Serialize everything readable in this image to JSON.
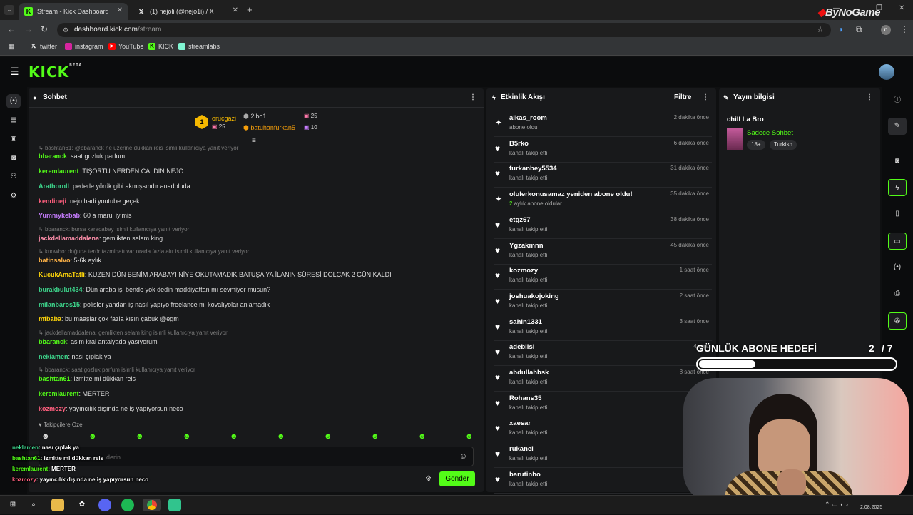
{
  "browser": {
    "tabs": [
      {
        "title": "Stream - Kick Dashboard",
        "active": true
      },
      {
        "title": "(1) nejoli (@nejo1i) / X",
        "active": false
      }
    ],
    "url_host": "dashboard.kick.com",
    "url_path": "/stream",
    "bookmarks": [
      "twitter",
      "instagram",
      "YouTube",
      "KICK",
      "streamlabs"
    ],
    "watermark": "ByNoGame"
  },
  "kick": {
    "logo": "KICK",
    "logo_badge": "BETA"
  },
  "chat": {
    "title": "Sohbet",
    "leaderboard": [
      {
        "rank": "1",
        "name": "orucgazi",
        "value": "25"
      },
      {
        "name": "2ibo1",
        "value": "25"
      },
      {
        "name": "batuhanfurkan5",
        "value": "10"
      }
    ],
    "messages": [
      {
        "type": "reply",
        "text": "bashtan61: @bbaranck ne üzerine dükkan reis isimli kullanıcıya yanıt veriyor"
      },
      {
        "type": "msg",
        "user": "bbaranck",
        "color": "#53fc18",
        "text": ": saat gozluk parfum"
      },
      {
        "type": "msg",
        "user": "keremlaurent",
        "color": "#53fc18",
        "text": ": TİŞÖRTÜ NERDEN CALDIN NEJO"
      },
      {
        "type": "msg",
        "user": "Arathornll",
        "color": "#3dd68c",
        "text": ": pederle yörük gibi akmışsındır anadoluda"
      },
      {
        "type": "msg",
        "user": "kendineji",
        "color": "#ff5f7e",
        "text": ": nejo hadi youtube geçek"
      },
      {
        "type": "msg",
        "user": "Yummykebab",
        "color": "#c77dff",
        "text": ": 60 a marul iyimis"
      },
      {
        "type": "reply",
        "text": "bbaranck: bursa karacabey isimli kullanıcıya yanıt veriyor"
      },
      {
        "type": "msg",
        "user": "jackdellamaddalena",
        "color": "#ff8fab",
        "text": ": gemlikten selam king"
      },
      {
        "type": "reply",
        "text": "knowho: doğuda terör tazminatı var orada fazla alır isimli kullanıcıya yanıt veriyor"
      },
      {
        "type": "msg",
        "user": "batinsalvo",
        "color": "#ffb347",
        "text": ": 5-6k aylık"
      },
      {
        "type": "msg",
        "user": "KucukAmaTatli",
        "color": "#ffd60a",
        "text": ": KUZEN DÜN BENİM ARABAYI NİYE OKUTAMADIK BATUŞA YA İLANIN SÜRESİ DOLCAK 2 GÜN KALDI"
      },
      {
        "type": "msg",
        "user": "burakbulut434",
        "color": "#3dd68c",
        "text": ": Dün araba işi bende yok dedin maddiyattan mı sevmiyor musun?"
      },
      {
        "type": "msg",
        "user": "milanbaros15",
        "color": "#3dd68c",
        "text": ": polisler yandan iş nasıl yapıyo freelance mi kovalıyolar anlamadık"
      },
      {
        "type": "msg",
        "user": "mfbaba",
        "color": "#ffd60a",
        "text": ": bu maaşlar çok fazla kısın çabuk @egm"
      },
      {
        "type": "reply",
        "text": "jackdellamaddalena: gemlikten selam king isimli kullanıcıya yanıt veriyor"
      },
      {
        "type": "msg",
        "user": "bbaranck",
        "color": "#53fc18",
        "text": ": aslm kral antalyada yasıyorum"
      },
      {
        "type": "msg",
        "user": "neklamen",
        "color": "#3dd68c",
        "text": ": nası çıplak ya"
      },
      {
        "type": "reply",
        "text": "bbaranck: saat gozluk parfum isimli kullanıcıya yanıt veriyor"
      },
      {
        "type": "msg",
        "user": "bashtan61",
        "color": "#53fc18",
        "text": ": izmitte mi dükkan reis"
      },
      {
        "type": "msg",
        "user": "keremlaurent",
        "color": "#53fc18",
        "text": ": MERTER"
      },
      {
        "type": "msg",
        "user": "kozmozy",
        "color": "#ff5f7e",
        "text": ": yayıncılık dışında ne iş yapıyorsun neco"
      }
    ],
    "followers_only": "Takipçilere Özel",
    "input_placeholder": "derin",
    "send_label": "Gönder"
  },
  "activity": {
    "title": "Etkinlik Akışı",
    "filter_label": "Filtre",
    "items": [
      {
        "icon": "sub",
        "name": "aikas_room",
        "sub": "abone oldu",
        "time": "2 dakika önce"
      },
      {
        "icon": "heart",
        "name": "B5rko",
        "sub": "kanalı takip etti",
        "time": "6 dakika önce"
      },
      {
        "icon": "heart",
        "name": "furkanbey5534",
        "sub": "kanalı takip etti",
        "time": "31 dakika önce"
      },
      {
        "icon": "sub",
        "name": "olulerkonusamaz yeniden abone oldu!",
        "sub": "aylık abone oldular",
        "sub_num": "2",
        "time": "35 dakika önce"
      },
      {
        "icon": "heart",
        "name": "etgz67",
        "sub": "kanalı takip etti",
        "time": "38 dakika önce"
      },
      {
        "icon": "heart",
        "name": "Ygzakmnn",
        "sub": "kanalı takip etti",
        "time": "45 dakika önce"
      },
      {
        "icon": "heart",
        "name": "kozmozy",
        "sub": "kanalı takip etti",
        "time": "1 saat önce"
      },
      {
        "icon": "heart",
        "name": "joshuakojoking",
        "sub": "kanalı takip etti",
        "time": "2 saat önce"
      },
      {
        "icon": "heart",
        "name": "sahin1331",
        "sub": "kanalı takip etti",
        "time": "3 saat önce"
      },
      {
        "icon": "heart",
        "name": "adebiisi",
        "sub": "kanalı takip etti",
        "time": "4 saat"
      },
      {
        "icon": "heart",
        "name": "abdullahbsk",
        "sub": "kanalı takip etti",
        "time": "8 saat önce"
      },
      {
        "icon": "heart",
        "name": "Rohans35",
        "sub": "kanalı takip etti",
        "time": "8"
      },
      {
        "icon": "heart",
        "name": "xaesar",
        "sub": "kanalı takip etti",
        "time": "11"
      },
      {
        "icon": "heart",
        "name": "rukanei",
        "sub": "kanalı takip etti",
        "time": "15"
      },
      {
        "icon": "heart",
        "name": "barutinho",
        "sub": "kanalı takip etti",
        "time": "15"
      }
    ]
  },
  "info": {
    "title": "Yayın bilgisi",
    "stream_title": "chill La Bro",
    "category": "Sadece Sohbet",
    "tags": [
      "18+",
      "Turkish"
    ]
  },
  "goal": {
    "label": "GÜNLÜK ABONE HEDEFİ",
    "current": "2",
    "target": "/ 7",
    "progress": 0.29
  },
  "overlay_chat": [
    {
      "user": "neklamen",
      "text": ": nası çıplak ya",
      "color": "#3dd68c"
    },
    {
      "user": "bashtan61",
      "text": ": izmitte mi dükkan reis",
      "color": "#53fc18"
    },
    {
      "user": "keremlaurent",
      "text": ": MERTER",
      "color": "#53fc18"
    },
    {
      "user": "kozmozy",
      "text": ": yayıncılık dışında ne iş yapıyorsun neco",
      "color": "#ff5f7e"
    }
  ],
  "taskbar": {
    "date": "2.08.2025"
  }
}
